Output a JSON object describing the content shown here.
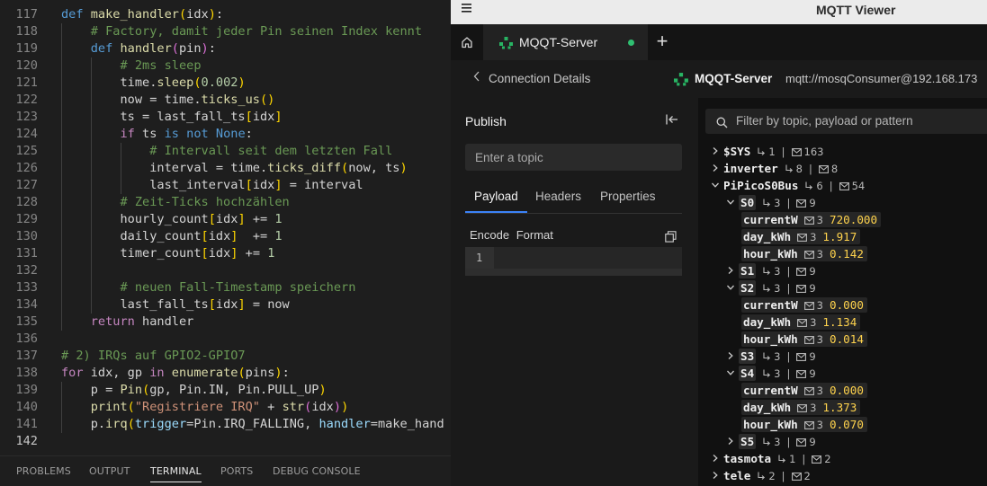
{
  "editor": {
    "lines": [
      {
        "n": "117",
        "indent": 0,
        "tokens": [
          [
            "kw",
            "def"
          ],
          [
            "pl",
            " "
          ],
          [
            "fn",
            "make_handler"
          ],
          [
            "p1",
            "("
          ],
          [
            "pl",
            "idx"
          ],
          [
            "p1",
            ")"
          ],
          [
            "pl",
            ":"
          ]
        ]
      },
      {
        "n": "118",
        "indent": 1,
        "tokens": [
          [
            "cm",
            "# Factory, damit jeder Pin seinen Index kennt"
          ]
        ]
      },
      {
        "n": "119",
        "indent": 1,
        "tokens": [
          [
            "kw",
            "def"
          ],
          [
            "pl",
            " "
          ],
          [
            "fn",
            "handler"
          ],
          [
            "p2",
            "("
          ],
          [
            "pl",
            "pin"
          ],
          [
            "p2",
            ")"
          ],
          [
            "pl",
            ":"
          ]
        ]
      },
      {
        "n": "120",
        "indent": 2,
        "tokens": [
          [
            "cm",
            "# 2ms sleep"
          ]
        ]
      },
      {
        "n": "121",
        "indent": 2,
        "tokens": [
          [
            "pl",
            "time."
          ],
          [
            "fn",
            "sleep"
          ],
          [
            "p1",
            "("
          ],
          [
            "num",
            "0.002"
          ],
          [
            "p1",
            ")"
          ]
        ]
      },
      {
        "n": "122",
        "indent": 2,
        "tokens": [
          [
            "pl",
            "now = time."
          ],
          [
            "fn",
            "ticks_us"
          ],
          [
            "p1",
            "()"
          ]
        ]
      },
      {
        "n": "123",
        "indent": 2,
        "tokens": [
          [
            "pl",
            "ts = last_fall_ts"
          ],
          [
            "p1",
            "["
          ],
          [
            "pl",
            "idx"
          ],
          [
            "p1",
            "]"
          ]
        ]
      },
      {
        "n": "124",
        "indent": 2,
        "tokens": [
          [
            "ctl",
            "if"
          ],
          [
            "pl",
            " ts "
          ],
          [
            "kw",
            "is not"
          ],
          [
            "pl",
            " "
          ],
          [
            "kw",
            "None"
          ],
          [
            "pl",
            ":"
          ]
        ]
      },
      {
        "n": "125",
        "indent": 3,
        "tokens": [
          [
            "cm",
            "# Intervall seit dem letzten Fall"
          ]
        ]
      },
      {
        "n": "126",
        "indent": 3,
        "tokens": [
          [
            "pl",
            "interval = time."
          ],
          [
            "fn",
            "ticks_diff"
          ],
          [
            "p1",
            "("
          ],
          [
            "pl",
            "now, ts"
          ],
          [
            "p1",
            ")"
          ]
        ]
      },
      {
        "n": "127",
        "indent": 3,
        "tokens": [
          [
            "pl",
            "last_interval"
          ],
          [
            "p1",
            "["
          ],
          [
            "pl",
            "idx"
          ],
          [
            "p1",
            "]"
          ],
          [
            "pl",
            " = interval"
          ]
        ]
      },
      {
        "n": "128",
        "indent": 2,
        "tokens": [
          [
            "cm",
            "# Zeit-Ticks hochzählen"
          ]
        ]
      },
      {
        "n": "129",
        "indent": 2,
        "tokens": [
          [
            "pl",
            "hourly_count"
          ],
          [
            "p1",
            "["
          ],
          [
            "pl",
            "idx"
          ],
          [
            "p1",
            "]"
          ],
          [
            "pl",
            " += "
          ],
          [
            "num",
            "1"
          ]
        ]
      },
      {
        "n": "130",
        "indent": 2,
        "tokens": [
          [
            "pl",
            "daily_count"
          ],
          [
            "p1",
            "["
          ],
          [
            "pl",
            "idx"
          ],
          [
            "p1",
            "]"
          ],
          [
            "pl",
            "  += "
          ],
          [
            "num",
            "1"
          ]
        ]
      },
      {
        "n": "131",
        "indent": 2,
        "tokens": [
          [
            "pl",
            "timer_count"
          ],
          [
            "p1",
            "["
          ],
          [
            "pl",
            "idx"
          ],
          [
            "p1",
            "]"
          ],
          [
            "pl",
            " += "
          ],
          [
            "num",
            "1"
          ]
        ]
      },
      {
        "n": "132",
        "indent": 2,
        "tokens": []
      },
      {
        "n": "133",
        "indent": 2,
        "tokens": [
          [
            "cm",
            "# neuen Fall-Timestamp speichern"
          ]
        ]
      },
      {
        "n": "134",
        "indent": 2,
        "tokens": [
          [
            "pl",
            "last_fall_ts"
          ],
          [
            "p1",
            "["
          ],
          [
            "pl",
            "idx"
          ],
          [
            "p1",
            "]"
          ],
          [
            "pl",
            " = now"
          ]
        ]
      },
      {
        "n": "135",
        "indent": 1,
        "tokens": [
          [
            "ctl",
            "return"
          ],
          [
            "pl",
            " handler"
          ]
        ]
      },
      {
        "n": "136",
        "indent": 0,
        "tokens": []
      },
      {
        "n": "137",
        "indent": 0,
        "tokens": [
          [
            "cm",
            "# 2) IRQs auf GPIO2-GPIO7"
          ]
        ]
      },
      {
        "n": "138",
        "indent": 0,
        "tokens": [
          [
            "ctl",
            "for"
          ],
          [
            "pl",
            " idx, gp "
          ],
          [
            "ctl",
            "in"
          ],
          [
            "pl",
            " "
          ],
          [
            "fn",
            "enumerate"
          ],
          [
            "p1",
            "("
          ],
          [
            "pl",
            "pins"
          ],
          [
            "p1",
            ")"
          ],
          [
            "pl",
            ":"
          ]
        ]
      },
      {
        "n": "139",
        "indent": 1,
        "tokens": [
          [
            "pl",
            "p = "
          ],
          [
            "fn",
            "Pin"
          ],
          [
            "p1",
            "("
          ],
          [
            "pl",
            "gp, Pin.IN, Pin.PULL_UP"
          ],
          [
            "p1",
            ")"
          ]
        ]
      },
      {
        "n": "140",
        "indent": 1,
        "tokens": [
          [
            "fn",
            "print"
          ],
          [
            "p1",
            "("
          ],
          [
            "str",
            "\"Registriere IRQ\""
          ],
          [
            "pl",
            " + "
          ],
          [
            "fn",
            "str"
          ],
          [
            "p2",
            "("
          ],
          [
            "pl",
            "idx"
          ],
          [
            "p2",
            ")"
          ],
          [
            "p1",
            ")"
          ]
        ]
      },
      {
        "n": "141",
        "indent": 1,
        "tokens": [
          [
            "pl",
            "p."
          ],
          [
            "fn",
            "irq"
          ],
          [
            "p1",
            "("
          ],
          [
            "var",
            "trigger"
          ],
          [
            "pl",
            "=Pin.IRQ_FALLING, "
          ],
          [
            "var",
            "handler"
          ],
          [
            "pl",
            "=make_hand"
          ]
        ]
      },
      {
        "n": "142",
        "indent": 0,
        "tokens": []
      }
    ]
  },
  "bottom_panel": {
    "tabs": [
      "PROBLEMS",
      "OUTPUT",
      "TERMINAL",
      "PORTS",
      "DEBUG CONSOLE"
    ],
    "active": "TERMINAL"
  },
  "viewer": {
    "window_title": "MQTT Viewer",
    "tab_label": "MQQT-Server",
    "back_label": "Connection Details",
    "server_name": "MQQT-Server",
    "server_url": "mqtt://mosqConsumer@192.168.173",
    "publish": {
      "title": "Publish",
      "topic_placeholder": "Enter a topic",
      "tabs": [
        "Payload",
        "Headers",
        "Properties"
      ],
      "encode_label": "Encode",
      "format_label": "Format",
      "line_number": "1"
    },
    "filter_placeholder": "Filter by topic, payload or pattern",
    "colors": {
      "status_connected": "#2fbf71",
      "accent": "#3b82f6",
      "value": "#ffd34d"
    },
    "tree": [
      {
        "depth": 0,
        "name": "$SYS",
        "expanded": false,
        "subtopics": "1",
        "messages": "163"
      },
      {
        "depth": 0,
        "name": "inverter",
        "expanded": false,
        "subtopics": "8",
        "messages": "8"
      },
      {
        "depth": 0,
        "name": "PiPicoS0Bus",
        "expanded": true,
        "subtopics": "6",
        "messages": "54"
      },
      {
        "depth": 1,
        "name": "S0",
        "expanded": true,
        "subtopics": "3",
        "messages": "9"
      },
      {
        "depth": 2,
        "name": "currentW",
        "leaf": true,
        "messages": "3",
        "value": "720.000"
      },
      {
        "depth": 2,
        "name": "day_kWh",
        "leaf": true,
        "messages": "3",
        "value": "1.917"
      },
      {
        "depth": 2,
        "name": "hour_kWh",
        "leaf": true,
        "messages": "3",
        "value": "0.142"
      },
      {
        "depth": 1,
        "name": "S1",
        "expanded": false,
        "subtopics": "3",
        "messages": "9"
      },
      {
        "depth": 1,
        "name": "S2",
        "expanded": true,
        "subtopics": "3",
        "messages": "9"
      },
      {
        "depth": 2,
        "name": "currentW",
        "leaf": true,
        "messages": "3",
        "value": "0.000"
      },
      {
        "depth": 2,
        "name": "day_kWh",
        "leaf": true,
        "messages": "3",
        "value": "1.134"
      },
      {
        "depth": 2,
        "name": "hour_kWh",
        "leaf": true,
        "messages": "3",
        "value": "0.014"
      },
      {
        "depth": 1,
        "name": "S3",
        "expanded": false,
        "subtopics": "3",
        "messages": "9"
      },
      {
        "depth": 1,
        "name": "S4",
        "expanded": true,
        "subtopics": "3",
        "messages": "9"
      },
      {
        "depth": 2,
        "name": "currentW",
        "leaf": true,
        "messages": "3",
        "value": "0.000"
      },
      {
        "depth": 2,
        "name": "day_kWh",
        "leaf": true,
        "messages": "3",
        "value": "1.373"
      },
      {
        "depth": 2,
        "name": "hour_kWh",
        "leaf": true,
        "messages": "3",
        "value": "0.070"
      },
      {
        "depth": 1,
        "name": "S5",
        "expanded": false,
        "subtopics": "3",
        "messages": "9"
      },
      {
        "depth": 0,
        "name": "tasmota",
        "expanded": false,
        "subtopics": "1",
        "messages": "2"
      },
      {
        "depth": 0,
        "name": "tele",
        "expanded": false,
        "subtopics": "2",
        "messages": "2"
      }
    ]
  }
}
